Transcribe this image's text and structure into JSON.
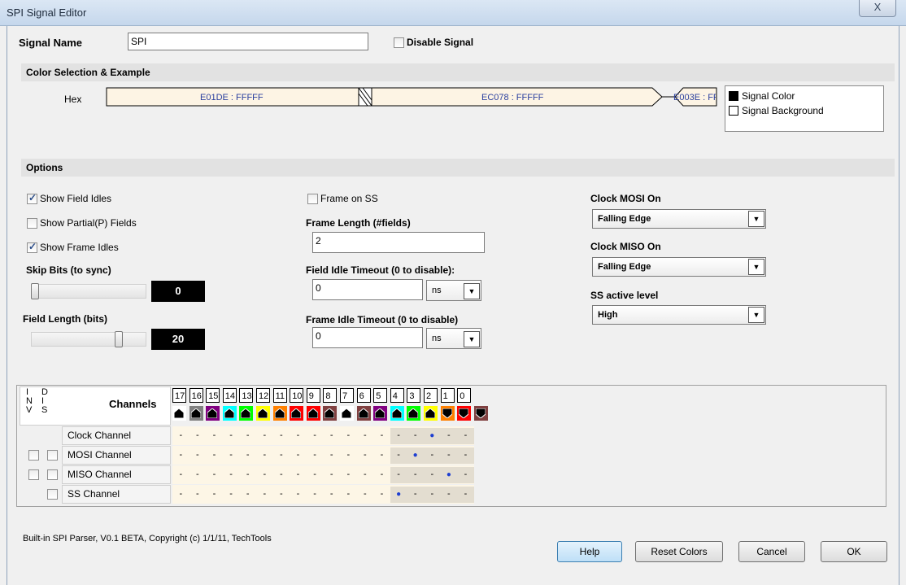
{
  "window": {
    "title": "SPI Signal Editor",
    "close_label": "X"
  },
  "signal": {
    "name_label": "Signal Name",
    "name_value": "SPI",
    "disable_label": "Disable  Signal",
    "disabled": false
  },
  "color_section": {
    "title": "Color Selection & Example",
    "hex_label": "Hex",
    "example_fields": [
      "E01DE : FFFFF",
      "EC078 : FFFFF",
      "E003E : FF"
    ],
    "legend": {
      "signal_color": "Signal Color",
      "signal_background": "Signal Background"
    }
  },
  "options": {
    "title": "Options",
    "show_field_idles": {
      "label": "Show Field Idles",
      "checked": true
    },
    "show_partial_fields": {
      "label": "Show Partial(P) Fields",
      "checked": false
    },
    "show_frame_idles": {
      "label": "Show Frame Idles",
      "checked": true
    },
    "skip_bits": {
      "label": "Skip Bits (to sync)",
      "value": "0",
      "fraction": 0.0
    },
    "field_length": {
      "label": "Field Length (bits)",
      "value": "20",
      "fraction": 0.78
    },
    "frame_on_ss": {
      "label": "Frame on SS",
      "checked": false
    },
    "frame_length": {
      "label": "Frame Length (#fields)",
      "value": "2"
    },
    "field_idle_timeout": {
      "label": "Field Idle Timeout (0 to disable):",
      "value": "0",
      "unit": "ns"
    },
    "frame_idle_timeout": {
      "label": "Frame Idle Timeout (0 to disable)",
      "value": "0",
      "unit": "ns"
    },
    "clock_mosi": {
      "label": "Clock MOSI On",
      "value": "Falling Edge"
    },
    "clock_miso": {
      "label": "Clock MISO On",
      "value": "Falling Edge"
    },
    "ss_level": {
      "label": "SS active level",
      "value": "High"
    }
  },
  "channels": {
    "inv_header": "I\nN\nV",
    "dis_header": "D\nI\nS",
    "title": "Channels",
    "numbers": [
      "17",
      "16",
      "15",
      "14",
      "13",
      "12",
      "11",
      "10",
      "9",
      "8",
      "7",
      "6",
      "5",
      "4",
      "3",
      "2",
      "1",
      "0"
    ],
    "colors": [
      "#ffffff",
      "#808080",
      "#800080",
      "#00ffff",
      "#00ff00",
      "#ffff00",
      "#ff8000",
      "#ff0000",
      "#ff0000",
      "#804040",
      "#ffffff",
      "#804040",
      "#800080",
      "#00ffff",
      "#00ff00",
      "#ffff00",
      "#ff8000",
      "#ff0000",
      "#804040"
    ],
    "rows": [
      {
        "label": "Clock Channel",
        "has_inv": false,
        "has_dis": false,
        "selected": 2
      },
      {
        "label": "MOSI Channel",
        "has_inv": true,
        "has_dis": true,
        "selected": 3
      },
      {
        "label": "MISO Channel",
        "has_inv": true,
        "has_dis": true,
        "selected": 1
      },
      {
        "label": "SS Channel",
        "has_inv": false,
        "has_dis": true,
        "selected": 4
      }
    ],
    "dash": "-"
  },
  "footer": {
    "copyright": "Built-in SPI Parser, V0.1 BETA, Copyright (c) 1/1/11, TechTools",
    "help": "Help",
    "reset": "Reset Colors",
    "cancel": "Cancel",
    "ok": "OK"
  }
}
